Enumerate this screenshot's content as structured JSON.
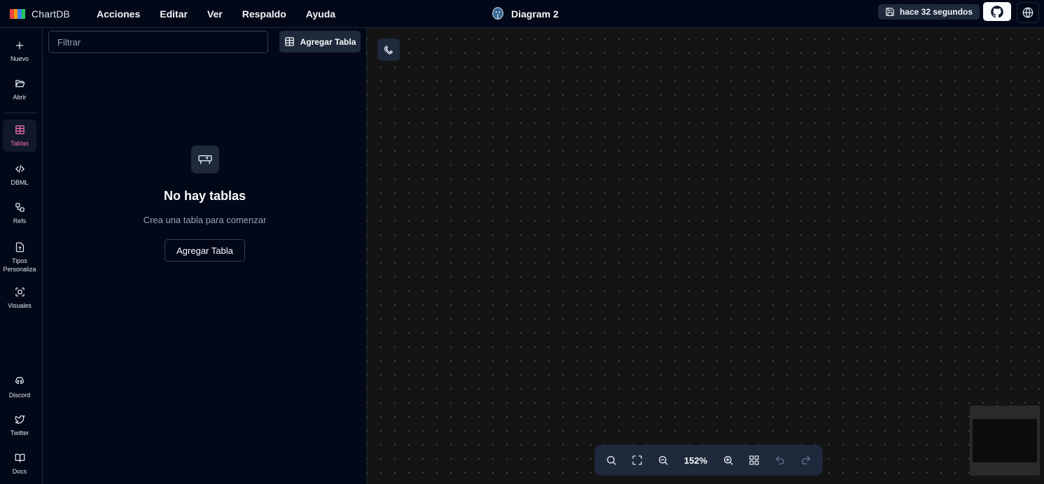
{
  "app": {
    "name": "ChartDB",
    "logo_colors": [
      "#ef4444",
      "#f59e0b",
      "#3b82f6",
      "#22c55e"
    ]
  },
  "menu": [
    "Acciones",
    "Editar",
    "Ver",
    "Respaldo",
    "Ayuda"
  ],
  "diagram": {
    "title": "Diagram 2",
    "db_icon": "postgresql-icon"
  },
  "save_status": {
    "text": "hace 32 segundos",
    "icon": "save-icon"
  },
  "header_icons": {
    "github": "github-icon",
    "language": "globe-icon"
  },
  "rail": {
    "top": [
      {
        "label": "Nuevo",
        "icon": "plus-icon"
      },
      {
        "label": "Abrir",
        "icon": "folder-open-icon"
      }
    ],
    "sections": [
      {
        "label": "Tablas",
        "icon": "table-icon",
        "active": true
      },
      {
        "label": "DBML",
        "icon": "code-icon"
      },
      {
        "label": "Refs",
        "icon": "workflow-icon"
      },
      {
        "label": "Tipos Personaliza",
        "icon": "file-type-icon"
      },
      {
        "label": "Visuales",
        "icon": "scan-icon"
      }
    ],
    "bottom": [
      {
        "label": "Discord",
        "icon": "discord-icon"
      },
      {
        "label": "Twitter",
        "icon": "twitter-icon"
      },
      {
        "label": "Docs",
        "icon": "book-open-icon"
      }
    ]
  },
  "panel": {
    "filter_placeholder": "Filtrar",
    "add_table_label": "Agregar Tabla",
    "empty_title": "No hay tablas",
    "empty_subtitle": "Crea una tabla para comenzar",
    "empty_button": "Agregar Tabla"
  },
  "canvas": {
    "zoom": "152%",
    "accent": "#f472b6",
    "toolbar_icons": [
      "search-icon",
      "fit-view-icon",
      "zoom-out-icon",
      "zoom-in-icon",
      "grid-icon",
      "undo-icon",
      "redo-icon"
    ]
  }
}
